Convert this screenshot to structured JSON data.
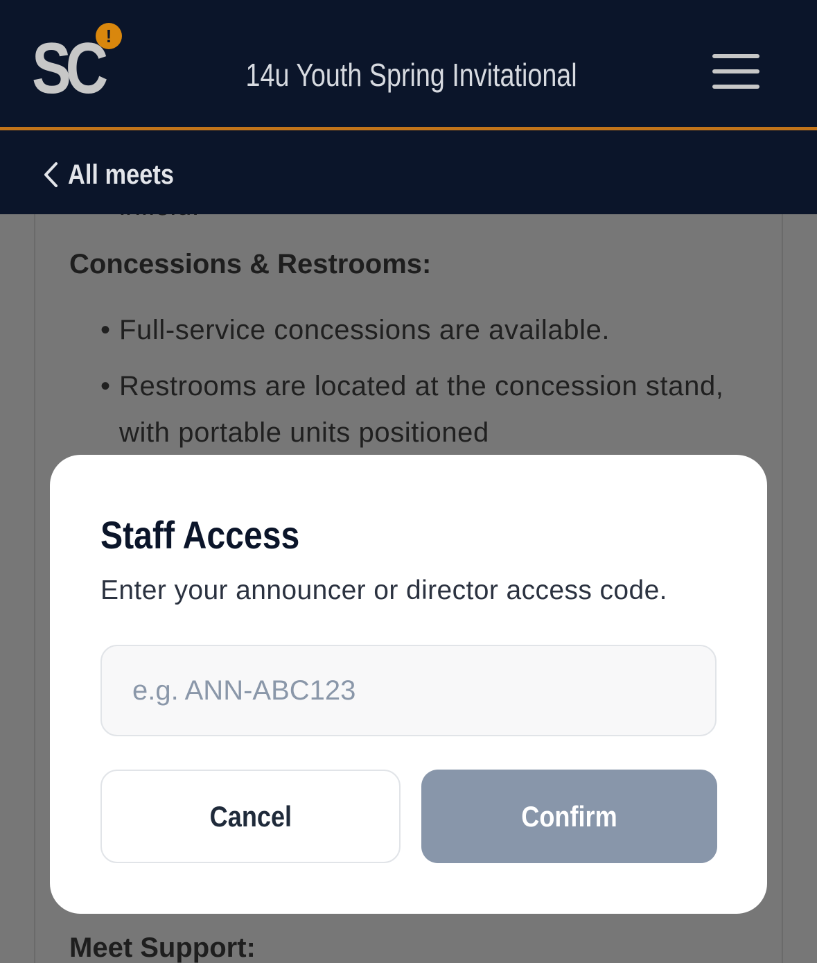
{
  "header": {
    "logo_text": "SC",
    "logo_badge": "!",
    "meet_title": "14u Youth Spring Invitational",
    "menu_icon": "hamburger-menu-icon",
    "back_link_label": "All meets",
    "back_icon": "chevron-left-icon"
  },
  "background": {
    "clipped_text": "infield.",
    "sections": [
      {
        "heading": "Concessions & Restrooms:",
        "bullets": [
          "Full-service concessions are available.",
          "Restrooms are located at the concession stand, with portable units positioned"
        ]
      },
      {
        "heading": "Meet Support:"
      }
    ]
  },
  "modal": {
    "title": "Staff Access",
    "description": "Enter your announcer or director access code.",
    "input_placeholder": "e.g. ANN-ABC123",
    "input_value": "",
    "cancel_label": "Cancel",
    "confirm_label": "Confirm"
  },
  "colors": {
    "header_bg": "#0b152a",
    "accent": "#c2741a",
    "badge": "#d9870d",
    "overlay": "#777777",
    "confirm_disabled": "#8896aa"
  }
}
